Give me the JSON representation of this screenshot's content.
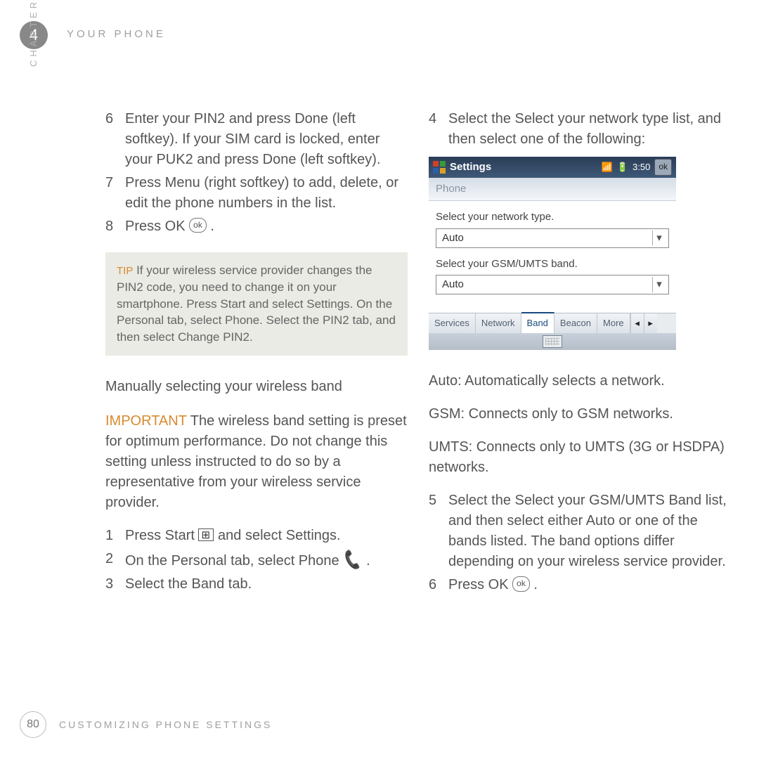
{
  "chapter_number": "4",
  "header_title": "YOUR PHONE",
  "chapter_label": "CHAPTER",
  "left": {
    "items": [
      {
        "n": "6",
        "t": "Enter your PIN2 and press Done (left softkey). If your SIM card is locked, enter your PUK2 and press Done (left softkey)."
      },
      {
        "n": "7",
        "t": "Press Menu (right softkey) to add, delete, or edit the phone numbers in the list."
      },
      {
        "n": "8",
        "t_pre": "Press OK ",
        "t_post": "."
      }
    ],
    "tip_label": "TIP",
    "tip_text": " If your wireless service provider changes the PIN2 code, you need to change it on your smartphone. Press Start and select Settings. On the Personal tab, select Phone. Select the PIN2 tab, and then select Change PIN2.",
    "subhead": "Manually selecting your wireless band",
    "important_label": "IMPORTANT",
    "important_text": "  The wireless band setting is preset for optimum performance. Do not change this setting unless instructed to do so by a representative from your wireless service provider.",
    "steps2": [
      {
        "n": "1",
        "t_pre": "Press Start ",
        "t_mid": " and select ",
        "t_post": " Settings."
      },
      {
        "n": "2",
        "t_pre": "On the Personal tab, select Phone ",
        "t_post": "."
      },
      {
        "n": "3",
        "t": "Select the Band tab."
      }
    ]
  },
  "right": {
    "intro": {
      "n": "4",
      "t": "Select the Select your network type list, and then select one of the following:"
    },
    "screenshot": {
      "title": "Settings",
      "time": "3:50",
      "ok": "ok",
      "subtitle": "Phone",
      "label1": "Select your network type.",
      "val1": "Auto",
      "label2": "Select your GSM/UMTS band.",
      "val2": "Auto",
      "tabs": [
        "Services",
        "Network",
        "Band",
        "Beacon",
        "More"
      ],
      "tab_selected_index": 2
    },
    "options": [
      "Auto: Automatically selects a network.",
      "GSM: Connects only to GSM networks.",
      "UMTS: Connects only to UMTS (3G or HSDPA) networks."
    ],
    "steps": [
      {
        "n": "5",
        "t": "Select the Select your GSM/UMTS Band list, and then select either Auto or one of the bands listed. The band options differ depending on your wireless service provider."
      },
      {
        "n": "6",
        "t_pre": "Press OK ",
        "t_post": "."
      }
    ]
  },
  "footer": {
    "page": "80",
    "text": "CUSTOMIZING PHONE SETTINGS"
  }
}
